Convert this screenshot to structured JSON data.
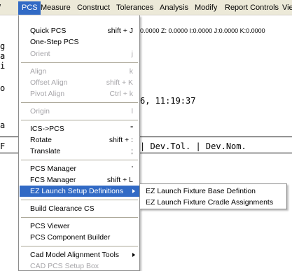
{
  "menubar": {
    "items": [
      "/",
      "PCS",
      "Measure",
      "Construct",
      "Tolerances",
      "Analysis",
      "Modify",
      "Report Controls",
      "Vie"
    ]
  },
  "editor": {
    "coords": "0.0000 Z: 0.0000 I:0.0000 J:0.0000 K:0.0000",
    "line_g": "g",
    "line_a": "a",
    "line_i": "i",
    "line_o": "o",
    "timestamp": "6, 11:19:37",
    "line_a2": "a",
    "line_f": "F",
    "header_cols": "| Dev.Tol. | Dev.Nom."
  },
  "menu": {
    "items": [
      {
        "label": "Quick PCS",
        "shortcut": "shift + J",
        "state": "enabled"
      },
      {
        "label": "One-Step PCS",
        "shortcut": "",
        "state": "enabled"
      },
      {
        "label": "Orient",
        "shortcut": "j",
        "state": "disabled"
      },
      {
        "label": "Align",
        "shortcut": "k",
        "state": "disabled"
      },
      {
        "label": "Offset Align",
        "shortcut": "shift + K",
        "state": "disabled"
      },
      {
        "label": "Pivot Align",
        "shortcut": "Ctrl + k",
        "state": "disabled"
      },
      {
        "label": "Origin",
        "shortcut": "l",
        "state": "disabled"
      },
      {
        "label": "ICS->PCS",
        "shortcut": "\"",
        "state": "enabled"
      },
      {
        "label": "Rotate",
        "shortcut": "shift + :",
        "state": "enabled"
      },
      {
        "label": "Translate",
        "shortcut": ";",
        "state": "enabled"
      },
      {
        "label": "PCS Manager",
        "shortcut": "'",
        "state": "enabled"
      },
      {
        "label": "FCS Manager",
        "shortcut": "shift + L",
        "state": "enabled"
      },
      {
        "label": "EZ Launch Setup Definitions",
        "shortcut": "",
        "state": "highlighted"
      },
      {
        "label": "Build Clearance CS",
        "shortcut": "",
        "state": "enabled"
      },
      {
        "label": "PCS Viewer",
        "shortcut": "",
        "state": "enabled"
      },
      {
        "label": "PCS Component Builder",
        "shortcut": "",
        "state": "enabled"
      },
      {
        "label": "Cad Model Alignment Tools",
        "shortcut": "",
        "state": "enabled"
      },
      {
        "label": "CAD PCS Setup Box",
        "shortcut": "",
        "state": "disabled"
      }
    ]
  },
  "submenu": {
    "items": [
      "EZ Launch Fixture Base Defintion",
      "EZ Launch Fixture Cradle Assignments"
    ]
  },
  "colors": {
    "highlight": "#316ac5",
    "menubar_bg": "#ece9d8",
    "disabled_text": "#a7a6aa"
  }
}
